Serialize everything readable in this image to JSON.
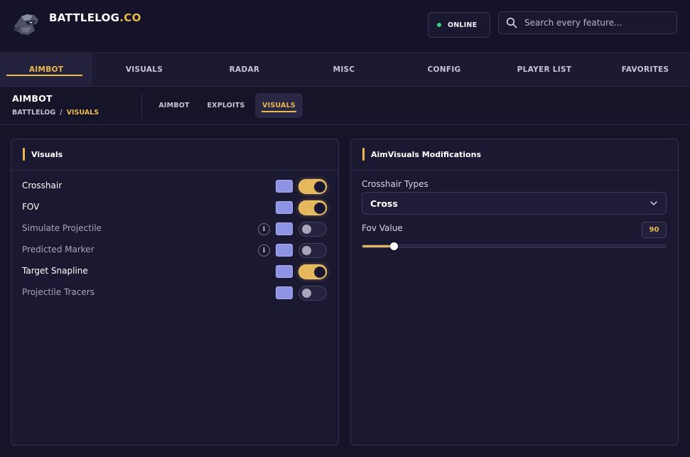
{
  "header": {
    "brand_name": "BATTLELOG",
    "brand_tld": ".CO",
    "status": "ONLINE",
    "search_placeholder": "Search every feature..."
  },
  "nav": {
    "items": [
      {
        "label": "AIMBOT",
        "active": true
      },
      {
        "label": "VISUALS",
        "active": false
      },
      {
        "label": "RADAR",
        "active": false
      },
      {
        "label": "MISC",
        "active": false
      },
      {
        "label": "CONFIG",
        "active": false
      },
      {
        "label": "PLAYER LIST",
        "active": false
      },
      {
        "label": "FAVORITES",
        "active": false
      }
    ]
  },
  "section": {
    "title": "AIMBOT",
    "breadcrumb_root": "BATTLELOG",
    "breadcrumb_sep": "/",
    "breadcrumb_current": "VISUALS",
    "subtabs": [
      {
        "label": "AIMBOT",
        "active": false
      },
      {
        "label": "EXPLOITS",
        "active": false
      },
      {
        "label": "VISUALS",
        "active": true
      }
    ]
  },
  "visuals_panel": {
    "title": "Visuals",
    "rows": [
      {
        "label": "Crosshair",
        "enabled": true,
        "info": false
      },
      {
        "label": "FOV",
        "enabled": true,
        "info": false
      },
      {
        "label": "Simulate Projectile",
        "enabled": false,
        "info": true
      },
      {
        "label": "Predicted Marker",
        "enabled": false,
        "info": true
      },
      {
        "label": "Target Snapline",
        "enabled": true,
        "info": false
      },
      {
        "label": "Projectile Tracers",
        "enabled": false,
        "info": false
      }
    ],
    "info_glyph": "i"
  },
  "mods_panel": {
    "title": "AimVisuals Modifications",
    "crosshair_types_label": "Crosshair Types",
    "crosshair_type_value": "Cross",
    "fov_label": "Fov Value",
    "fov_value": "90",
    "fov_fraction": 0.103
  },
  "colors": {
    "accent": "#e9b949",
    "swatch": "#8f93e4",
    "online": "#3ad07a",
    "background": "#161428"
  }
}
